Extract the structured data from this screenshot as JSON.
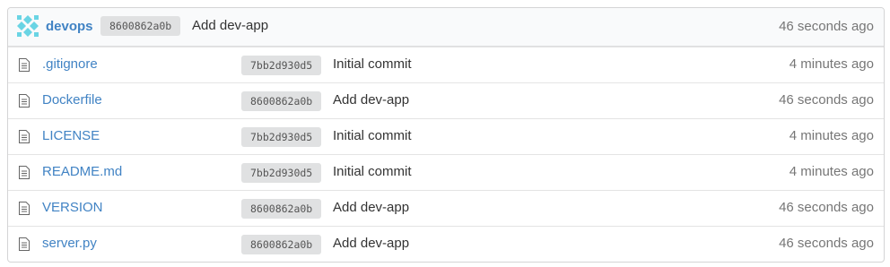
{
  "latest_commit": {
    "author": "devops",
    "sha": "8600862a0b",
    "message": "Add dev-app",
    "time": "46 seconds ago"
  },
  "files": [
    {
      "name": ".gitignore",
      "icon": "file-text-icon",
      "sha": "7bb2d930d5",
      "message": "Initial commit",
      "time": "4 minutes ago"
    },
    {
      "name": "Dockerfile",
      "icon": "file-text-icon",
      "sha": "8600862a0b",
      "message": "Add dev-app",
      "time": "46 seconds ago"
    },
    {
      "name": "LICENSE",
      "icon": "file-text-icon",
      "sha": "7bb2d930d5",
      "message": "Initial commit",
      "time": "4 minutes ago"
    },
    {
      "name": "README.md",
      "icon": "file-text-icon",
      "sha": "7bb2d930d5",
      "message": "Initial commit",
      "time": "4 minutes ago"
    },
    {
      "name": "VERSION",
      "icon": "file-text-icon",
      "sha": "8600862a0b",
      "message": "Add dev-app",
      "time": "46 seconds ago"
    },
    {
      "name": "server.py",
      "icon": "file-text-icon",
      "sha": "8600862a0b",
      "message": "Add dev-app",
      "time": "46 seconds ago"
    }
  ],
  "colors": {
    "link": "#4183c4",
    "sha_background": "#e0e1e2",
    "avatar": "#6ad4e4",
    "muted_text": "#767676"
  }
}
